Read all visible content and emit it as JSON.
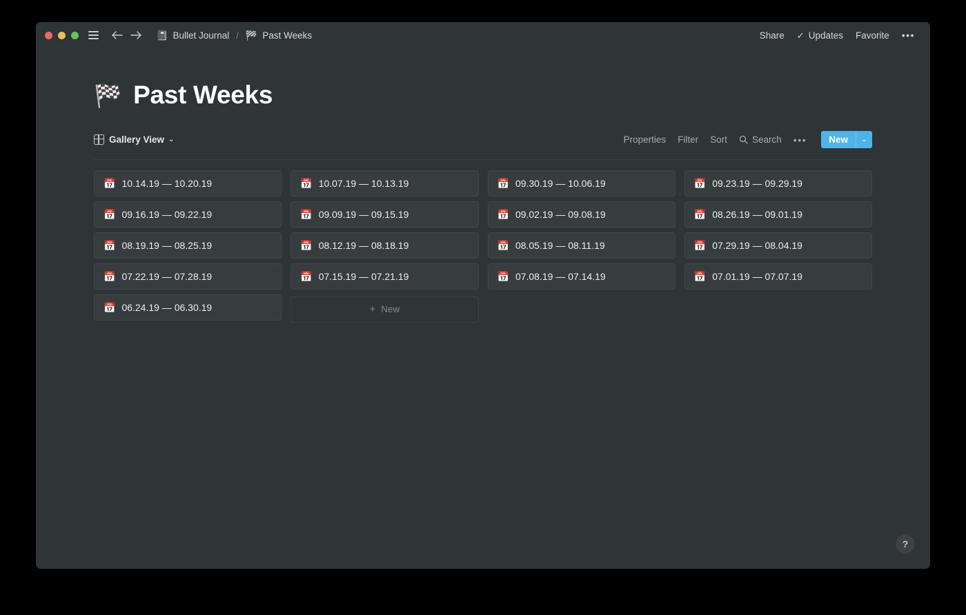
{
  "window": {
    "traffic_lights": [
      {
        "name": "close",
        "color": "#ED6A5E"
      },
      {
        "name": "minimize",
        "color": "#F4BD4F"
      },
      {
        "name": "maximize",
        "color": "#61C454"
      }
    ],
    "breadcrumb": [
      {
        "emoji": "📓",
        "icon_name": "notebook-icon",
        "label": "Bullet Journal"
      },
      {
        "emoji": "🏁",
        "icon_name": "checkered-flag-icon",
        "label": "Past Weeks"
      }
    ],
    "breadcrumb_separator": "/",
    "actions": {
      "share": "Share",
      "updates": "Updates",
      "updates_check": "✓",
      "favorite": "Favorite",
      "more": "•••"
    }
  },
  "page": {
    "emoji": "🏁",
    "title": "Past Weeks"
  },
  "toolbar": {
    "view_label": "Gallery View",
    "view_caret": "⌄",
    "properties": "Properties",
    "filter": "Filter",
    "sort": "Sort",
    "search": "Search",
    "more": "•••",
    "new_label": "New",
    "new_caret": "⌄",
    "accent_color": "#4FB4E8"
  },
  "gallery": {
    "card_emoji": "📅",
    "cards": [
      {
        "title": "10.14.19 — 10.20.19"
      },
      {
        "title": "10.07.19 — 10.13.19"
      },
      {
        "title": "09.30.19 — 10.06.19"
      },
      {
        "title": "09.23.19 — 09.29.19"
      },
      {
        "title": "09.16.19 — 09.22.19"
      },
      {
        "title": "09.09.19 — 09.15.19"
      },
      {
        "title": "09.02.19 — 09.08.19"
      },
      {
        "title": "08.26.19 — 09.01.19"
      },
      {
        "title": "08.19.19 — 08.25.19"
      },
      {
        "title": "08.12.19 — 08.18.19"
      },
      {
        "title": "08.05.19 — 08.11.19"
      },
      {
        "title": "07.29.19 — 08.04.19"
      },
      {
        "title": "07.22.19 — 07.28.19"
      },
      {
        "title": "07.15.19 — 07.21.19"
      },
      {
        "title": "07.08.19 — 07.14.19"
      },
      {
        "title": "07.01.19 — 07.07.19"
      },
      {
        "title": "06.24.19 — 06.30.19"
      }
    ],
    "new_card_label": "New",
    "new_card_plus": "+"
  },
  "help": {
    "label": "?"
  }
}
